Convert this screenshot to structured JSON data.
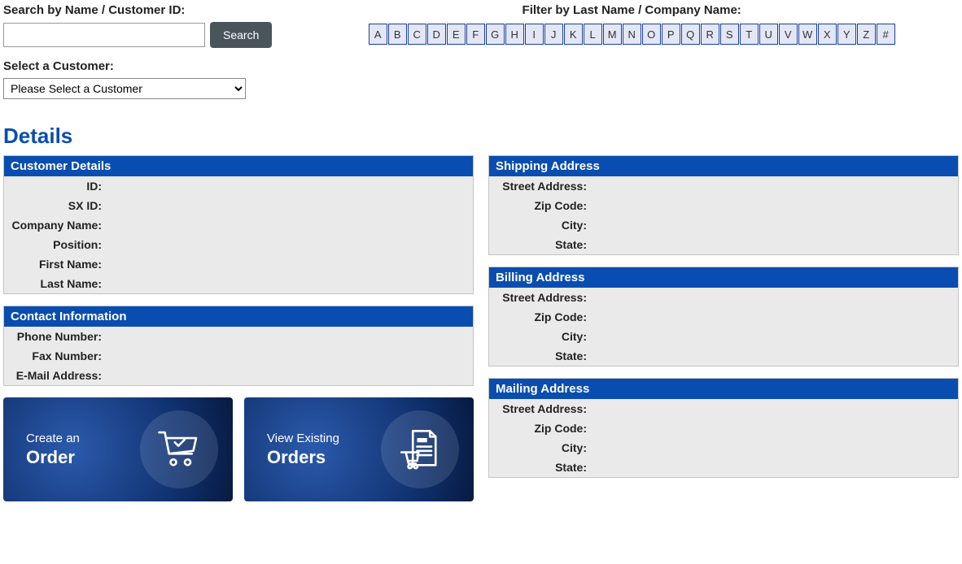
{
  "search": {
    "label": "Search by Name / Customer ID:",
    "button": "Search",
    "value": ""
  },
  "select": {
    "label": "Select a Customer:",
    "placeholder": "Please Select a Customer"
  },
  "filter": {
    "label": "Filter by Last Name / Company Name:",
    "letters": [
      "A",
      "B",
      "C",
      "D",
      "E",
      "F",
      "G",
      "H",
      "I",
      "J",
      "K",
      "L",
      "M",
      "N",
      "O",
      "P",
      "Q",
      "R",
      "S",
      "T",
      "U",
      "V",
      "W",
      "X",
      "Y",
      "Z",
      "#"
    ]
  },
  "details_title": "Details",
  "panels": {
    "customer": {
      "title": "Customer Details",
      "fields": [
        {
          "label": "ID:",
          "value": ""
        },
        {
          "label": "SX ID:",
          "value": ""
        },
        {
          "label": "Company Name:",
          "value": ""
        },
        {
          "label": "Position:",
          "value": ""
        },
        {
          "label": "First Name:",
          "value": ""
        },
        {
          "label": "Last Name:",
          "value": ""
        }
      ]
    },
    "contact": {
      "title": "Contact Information",
      "fields": [
        {
          "label": "Phone Number:",
          "value": ""
        },
        {
          "label": "Fax Number:",
          "value": ""
        },
        {
          "label": "E-Mail Address:",
          "value": ""
        }
      ]
    },
    "shipping": {
      "title": "Shipping Address",
      "fields": [
        {
          "label": "Street Address:",
          "value": ""
        },
        {
          "label": "Zip Code:",
          "value": ""
        },
        {
          "label": "City:",
          "value": ""
        },
        {
          "label": "State:",
          "value": ""
        }
      ]
    },
    "billing": {
      "title": "Billing Address",
      "fields": [
        {
          "label": "Street Address:",
          "value": ""
        },
        {
          "label": "Zip Code:",
          "value": ""
        },
        {
          "label": "City:",
          "value": ""
        },
        {
          "label": "State:",
          "value": ""
        }
      ]
    },
    "mailing": {
      "title": "Mailing Address",
      "fields": [
        {
          "label": "Street Address:",
          "value": ""
        },
        {
          "label": "Zip Code:",
          "value": ""
        },
        {
          "label": "City:",
          "value": ""
        },
        {
          "label": "State:",
          "value": ""
        }
      ]
    }
  },
  "cta": {
    "create": {
      "line1": "Create an",
      "line2": "Order"
    },
    "view": {
      "line1": "View Existing",
      "line2": "Orders"
    }
  }
}
